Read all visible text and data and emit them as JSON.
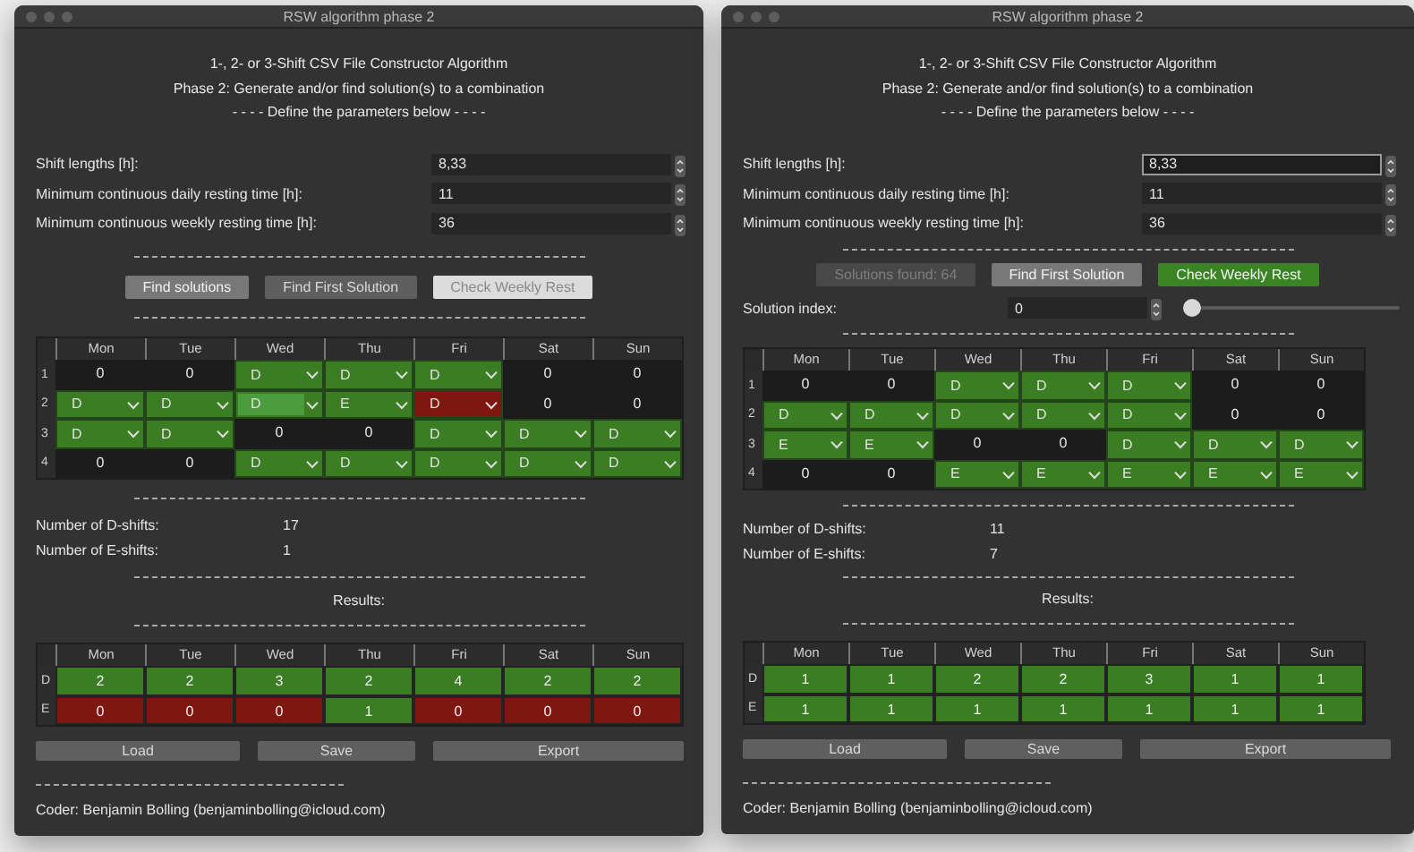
{
  "windows": [
    {
      "title": "RSW algorithm phase 2",
      "heading": [
        "1-, 2- or 3-Shift CSV File Constructor Algorithm",
        "Phase 2: Generate and/or find solution(s) to a combination",
        "- - - -  Define the parameters below  - - - -"
      ],
      "parameters": [
        {
          "label": "Shift lengths [h]:",
          "value": "8,33",
          "focused": false
        },
        {
          "label": "Minimum continuous daily resting time [h]:",
          "value": "11",
          "focused": false
        },
        {
          "label": "Minimum continuous weekly resting time [h]:",
          "value": "36",
          "focused": false
        }
      ],
      "actions": [
        {
          "label": "Find solutions",
          "default": true,
          "highlighted": false,
          "disabled": false,
          "success": false
        },
        {
          "label": "Find First Solution",
          "default": false,
          "highlighted": false,
          "disabled": false,
          "success": false
        },
        {
          "label": "Check Weekly Rest",
          "default": false,
          "highlighted": true,
          "disabled": false,
          "success": false
        }
      ],
      "schedule": {
        "columns": [
          "Mon",
          "Tue",
          "Wed",
          "Thu",
          "Fri",
          "Sat",
          "Sun"
        ],
        "rows": [
          {
            "label": "1",
            "cells": [
              {
                "kind": "number",
                "value": "0"
              },
              {
                "kind": "number",
                "value": "0"
              },
              {
                "kind": "choice",
                "value": "D",
                "color": "#3a7d22",
                "focused": false
              },
              {
                "kind": "choice",
                "value": "D",
                "color": "#3a7d22",
                "focused": false
              },
              {
                "kind": "choice",
                "value": "D",
                "color": "#3a7d22",
                "focused": false
              },
              {
                "kind": "number",
                "value": "0"
              },
              {
                "kind": "number",
                "value": "0"
              }
            ]
          },
          {
            "label": "2",
            "cells": [
              {
                "kind": "choice",
                "value": "D",
                "color": "#3a7d22",
                "focused": false
              },
              {
                "kind": "choice",
                "value": "D",
                "color": "#3a7d22",
                "focused": false
              },
              {
                "kind": "choice",
                "value": "D",
                "color": "#3a7d22",
                "focused": true
              },
              {
                "kind": "choice",
                "value": "E",
                "color": "#3a7d22",
                "focused": false
              },
              {
                "kind": "choice",
                "value": "D",
                "color": "#7d1710",
                "focused": false
              },
              {
                "kind": "number",
                "value": "0"
              },
              {
                "kind": "number",
                "value": "0"
              }
            ]
          },
          {
            "label": "3",
            "cells": [
              {
                "kind": "choice",
                "value": "D",
                "color": "#3a7d22",
                "focused": false
              },
              {
                "kind": "choice",
                "value": "D",
                "color": "#3a7d22",
                "focused": false
              },
              {
                "kind": "number",
                "value": "0"
              },
              {
                "kind": "number",
                "value": "0"
              },
              {
                "kind": "choice",
                "value": "D",
                "color": "#3a7d22",
                "focused": false
              },
              {
                "kind": "choice",
                "value": "D",
                "color": "#3a7d22",
                "focused": false
              },
              {
                "kind": "choice",
                "value": "D",
                "color": "#3a7d22",
                "focused": false
              }
            ]
          },
          {
            "label": "4",
            "cells": [
              {
                "kind": "number",
                "value": "0"
              },
              {
                "kind": "number",
                "value": "0"
              },
              {
                "kind": "choice",
                "value": "D",
                "color": "#3a7d22",
                "focused": false
              },
              {
                "kind": "choice",
                "value": "D",
                "color": "#3a7d22",
                "focused": false
              },
              {
                "kind": "choice",
                "value": "D",
                "color": "#3a7d22",
                "focused": false
              },
              {
                "kind": "choice",
                "value": "D",
                "color": "#3a7d22",
                "focused": false
              },
              {
                "kind": "choice",
                "value": "D",
                "color": "#3a7d22",
                "focused": false
              }
            ]
          }
        ]
      },
      "counts": [
        {
          "label": "Number of D-shifts:",
          "value": "17"
        },
        {
          "label": "Number of E-shifts:",
          "value": "1"
        }
      ],
      "results_label": "Results:",
      "results": {
        "columns": [
          "Mon",
          "Tue",
          "Wed",
          "Thu",
          "Fri",
          "Sat",
          "Sun"
        ],
        "rows": [
          {
            "label": "D",
            "cells": [
              {
                "value": "2",
                "color": "#3a7d22"
              },
              {
                "value": "2",
                "color": "#3a7d22"
              },
              {
                "value": "3",
                "color": "#3a7d22"
              },
              {
                "value": "2",
                "color": "#3a7d22"
              },
              {
                "value": "4",
                "color": "#3a7d22"
              },
              {
                "value": "2",
                "color": "#3a7d22"
              },
              {
                "value": "2",
                "color": "#3a7d22"
              }
            ]
          },
          {
            "label": "E",
            "cells": [
              {
                "value": "0",
                "color": "#7d1710"
              },
              {
                "value": "0",
                "color": "#7d1710"
              },
              {
                "value": "0",
                "color": "#7d1710"
              },
              {
                "value": "1",
                "color": "#3a7d22"
              },
              {
                "value": "0",
                "color": "#7d1710"
              },
              {
                "value": "0",
                "color": "#7d1710"
              },
              {
                "value": "0",
                "color": "#7d1710"
              }
            ]
          }
        ]
      },
      "file_buttons": [
        "Load",
        "Save",
        "Export"
      ],
      "footer": "Coder: Benjamin Bolling (benjaminbolling@icloud.com)"
    },
    {
      "title": "RSW algorithm phase 2",
      "heading": [
        "1-, 2- or 3-Shift CSV File Constructor Algorithm",
        "Phase 2: Generate and/or find solution(s) to a combination",
        "- - - -  Define the parameters below  - - - -"
      ],
      "parameters": [
        {
          "label": "Shift lengths [h]:",
          "value": "8,33",
          "focused": true
        },
        {
          "label": "Minimum continuous daily resting time [h]:",
          "value": "11",
          "focused": false
        },
        {
          "label": "Minimum continuous weekly resting time [h]:",
          "value": "36",
          "focused": false
        }
      ],
      "actions": [
        {
          "label": "Solutions found: 64",
          "default": false,
          "highlighted": false,
          "disabled": true,
          "success": false
        },
        {
          "label": "Find First Solution",
          "default": true,
          "highlighted": false,
          "disabled": false,
          "success": false
        },
        {
          "label": "Check Weekly Rest",
          "default": false,
          "highlighted": false,
          "disabled": false,
          "success": true
        }
      ],
      "solution_index": {
        "label": "Solution index:",
        "value": "0",
        "level": 0
      },
      "schedule": {
        "columns": [
          "Mon",
          "Tue",
          "Wed",
          "Thu",
          "Fri",
          "Sat",
          "Sun"
        ],
        "rows": [
          {
            "label": "1",
            "cells": [
              {
                "kind": "number",
                "value": "0"
              },
              {
                "kind": "number",
                "value": "0"
              },
              {
                "kind": "choice",
                "value": "D",
                "color": "#3a7d22",
                "focused": false
              },
              {
                "kind": "choice",
                "value": "D",
                "color": "#3a7d22",
                "focused": false
              },
              {
                "kind": "choice",
                "value": "D",
                "color": "#3a7d22",
                "focused": false
              },
              {
                "kind": "number",
                "value": "0"
              },
              {
                "kind": "number",
                "value": "0"
              }
            ]
          },
          {
            "label": "2",
            "cells": [
              {
                "kind": "choice",
                "value": "D",
                "color": "#3a7d22",
                "focused": false
              },
              {
                "kind": "choice",
                "value": "D",
                "color": "#3a7d22",
                "focused": false
              },
              {
                "kind": "choice",
                "value": "D",
                "color": "#3a7d22",
                "focused": false
              },
              {
                "kind": "choice",
                "value": "D",
                "color": "#3a7d22",
                "focused": false
              },
              {
                "kind": "choice",
                "value": "D",
                "color": "#3a7d22",
                "focused": false
              },
              {
                "kind": "number",
                "value": "0"
              },
              {
                "kind": "number",
                "value": "0"
              }
            ]
          },
          {
            "label": "3",
            "cells": [
              {
                "kind": "choice",
                "value": "E",
                "color": "#3a7d22",
                "focused": false
              },
              {
                "kind": "choice",
                "value": "E",
                "color": "#3a7d22",
                "focused": false
              },
              {
                "kind": "number",
                "value": "0"
              },
              {
                "kind": "number",
                "value": "0"
              },
              {
                "kind": "choice",
                "value": "D",
                "color": "#3a7d22",
                "focused": false
              },
              {
                "kind": "choice",
                "value": "D",
                "color": "#3a7d22",
                "focused": false
              },
              {
                "kind": "choice",
                "value": "D",
                "color": "#3a7d22",
                "focused": false
              }
            ]
          },
          {
            "label": "4",
            "cells": [
              {
                "kind": "number",
                "value": "0"
              },
              {
                "kind": "number",
                "value": "0"
              },
              {
                "kind": "choice",
                "value": "E",
                "color": "#3a7d22",
                "focused": false
              },
              {
                "kind": "choice",
                "value": "E",
                "color": "#3a7d22",
                "focused": false
              },
              {
                "kind": "choice",
                "value": "E",
                "color": "#3a7d22",
                "focused": false
              },
              {
                "kind": "choice",
                "value": "E",
                "color": "#3a7d22",
                "focused": false
              },
              {
                "kind": "choice",
                "value": "E",
                "color": "#3a7d22",
                "focused": false
              }
            ]
          }
        ]
      },
      "counts": [
        {
          "label": "Number of D-shifts:",
          "value": "11"
        },
        {
          "label": "Number of E-shifts:",
          "value": "7"
        }
      ],
      "results_label": "Results:",
      "results": {
        "columns": [
          "Mon",
          "Tue",
          "Wed",
          "Thu",
          "Fri",
          "Sat",
          "Sun"
        ],
        "rows": [
          {
            "label": "D",
            "cells": [
              {
                "value": "1",
                "color": "#3a7d22"
              },
              {
                "value": "1",
                "color": "#3a7d22"
              },
              {
                "value": "2",
                "color": "#3a7d22"
              },
              {
                "value": "2",
                "color": "#3a7d22"
              },
              {
                "value": "3",
                "color": "#3a7d22"
              },
              {
                "value": "1",
                "color": "#3a7d22"
              },
              {
                "value": "1",
                "color": "#3a7d22"
              }
            ]
          },
          {
            "label": "E",
            "cells": [
              {
                "value": "1",
                "color": "#3a7d22"
              },
              {
                "value": "1",
                "color": "#3a7d22"
              },
              {
                "value": "1",
                "color": "#3a7d22"
              },
              {
                "value": "1",
                "color": "#3a7d22"
              },
              {
                "value": "1",
                "color": "#3a7d22"
              },
              {
                "value": "1",
                "color": "#3a7d22"
              },
              {
                "value": "1",
                "color": "#3a7d22"
              }
            ]
          }
        ]
      },
      "file_buttons": [
        "Load",
        "Save",
        "Export"
      ],
      "footer": "Coder: Benjamin Bolling (benjaminbolling@icloud.com)"
    }
  ]
}
